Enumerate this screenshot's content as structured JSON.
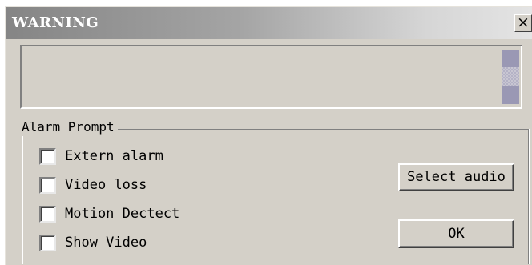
{
  "window": {
    "title": "WARNING",
    "close_glyph": "✕"
  },
  "message": {
    "text": ""
  },
  "alarm_prompt": {
    "label": "Alarm Prompt",
    "options": [
      {
        "label": "Extern alarm",
        "checked": false
      },
      {
        "label": "Video loss",
        "checked": false
      },
      {
        "label": "Motion Dectect",
        "checked": false
      },
      {
        "label": "Show Video",
        "checked": false
      }
    ]
  },
  "buttons": {
    "select_audio": "Select audio",
    "ok": "OK"
  }
}
